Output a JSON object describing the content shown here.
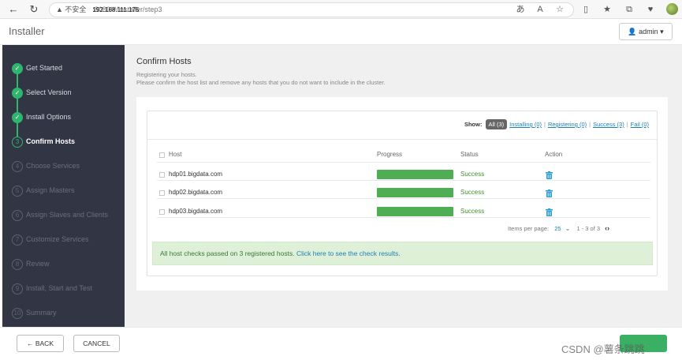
{
  "browser": {
    "security_warning": "▲ 不安全",
    "url_host": "192.168.111.175",
    "url_path": ":8080/#/installer/step3"
  },
  "header": {
    "brand": "Installer",
    "user_menu": "admin"
  },
  "sidebar": {
    "steps": [
      {
        "num": "✓",
        "label": "Get Started",
        "state": "done"
      },
      {
        "num": "✓",
        "label": "Select Version",
        "state": "done"
      },
      {
        "num": "✓",
        "label": "Install Options",
        "state": "done"
      },
      {
        "num": "3",
        "label": "Confirm Hosts",
        "state": "current"
      },
      {
        "num": "4",
        "label": "Choose Services",
        "state": "todo"
      },
      {
        "num": "5",
        "label": "Assign Masters",
        "state": "todo"
      },
      {
        "num": "6",
        "label": "Assign Slaves and Clients",
        "state": "todo"
      },
      {
        "num": "7",
        "label": "Customize Services",
        "state": "todo"
      },
      {
        "num": "8",
        "label": "Review",
        "state": "todo"
      },
      {
        "num": "9",
        "label": "Install, Start and Test",
        "state": "todo"
      },
      {
        "num": "10",
        "label": "Summary",
        "state": "todo"
      }
    ]
  },
  "main": {
    "title": "Confirm Hosts",
    "desc1": "Registering your hosts.",
    "desc2": "Please confirm the host list and remove any hosts that you do not want to include in the cluster.",
    "filters": {
      "show_label": "Show:",
      "all": "All (3)",
      "installing": "Installing (0)",
      "registering": "Registering (0)",
      "success": "Success (3)",
      "fail": "Fail (0)"
    },
    "columns": {
      "host": "Host",
      "progress": "Progress",
      "status": "Status",
      "action": "Action"
    },
    "rows": [
      {
        "host": "hdp01.bigdata.com",
        "progress": 1.0,
        "status": "Success"
      },
      {
        "host": "hdp02.bigdata.com",
        "progress": 1.0,
        "status": "Success"
      },
      {
        "host": "hdp03.bigdata.com",
        "progress": 1.0,
        "status": "Success"
      }
    ],
    "pager": {
      "items_per_page_label": "Items per page:",
      "items_per_page": "25",
      "range": "1 - 3 of 3"
    },
    "alert": {
      "text": "All host checks passed on 3 registered hosts.",
      "link": "Click here to see the check results."
    }
  },
  "footer": {
    "back": "← BACK",
    "cancel": "CANCEL",
    "watermark": "CSDN @薯条跳跳"
  },
  "colors": {
    "sidebar_bg": "#323544",
    "success_green": "#2fb66e",
    "progress_green": "#4fae53",
    "link_blue": "#1d7fb5",
    "alert_bg": "#dff0d8"
  }
}
